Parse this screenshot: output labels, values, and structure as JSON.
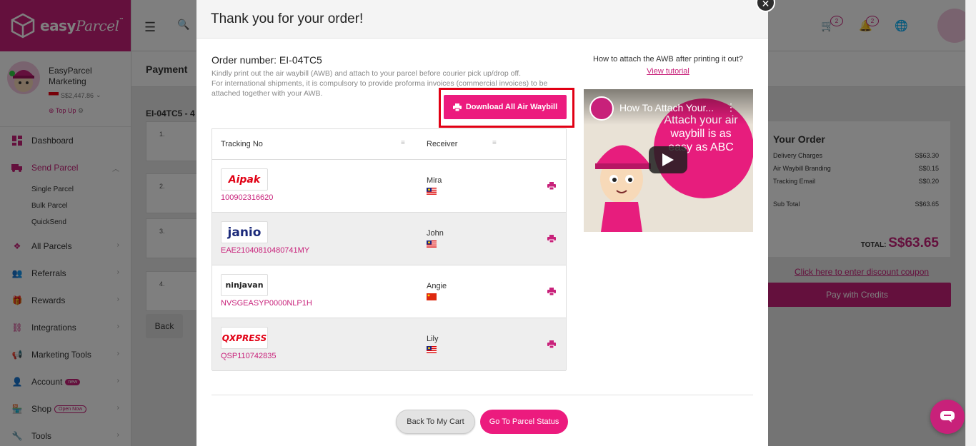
{
  "app": {
    "brand_prefix": "easy",
    "brand_suffix": "Parcel",
    "trademark": "™",
    "accent": "#c8217a"
  },
  "profile": {
    "name": "EasyParcel Marketing",
    "balance": "S$2,447.86",
    "topup_label": "Top Up"
  },
  "nav": {
    "items": [
      {
        "label": "Dashboard",
        "icon": "dashboard-icon"
      },
      {
        "label": "Send Parcel",
        "icon": "truck-icon"
      },
      {
        "label": "All Parcels",
        "icon": "boxes-icon"
      },
      {
        "label": "Referrals",
        "icon": "people-icon"
      },
      {
        "label": "Rewards",
        "icon": "gift-icon"
      },
      {
        "label": "Integrations",
        "icon": "link-icon"
      },
      {
        "label": "Marketing Tools",
        "icon": "megaphone-icon"
      },
      {
        "label": "Account",
        "icon": "user-icon",
        "badge": "new"
      },
      {
        "label": "Shop",
        "icon": "shop-icon",
        "badge": "Open Now"
      },
      {
        "label": "Tools",
        "icon": "wrench-icon"
      }
    ],
    "sub_items": [
      "Single Parcel",
      "Bulk Parcel",
      "QuickSend"
    ]
  },
  "topbar": {
    "cart_count": "2",
    "notif_count": "2"
  },
  "page": {
    "title": "Payment",
    "order_ref": "EI-04TC5 - 4",
    "back_label": "Back",
    "bg_rows": [
      "1.",
      "2.",
      "3.",
      "4."
    ]
  },
  "summary": {
    "title": "Your Order",
    "lines": [
      {
        "label": "Delivery Charges",
        "value": "S$63.30"
      },
      {
        "label": "Air Waybill Branding",
        "value": "S$0.15"
      },
      {
        "label": "Tracking Email",
        "value": "S$0.20"
      },
      {
        "label": "Sub Total",
        "value": "S$63.65"
      }
    ],
    "total_label": "TOTAL:",
    "total_value": "S$63.65",
    "coupon_link": "Click here to enter discount coupon",
    "pay_label": "Pay with Credits"
  },
  "modal": {
    "title": "Thank you for your order!",
    "order_number": "Order number: EI-04TC5",
    "instruction_1": "Kindly print out the air waybill (AWB) and attach to your parcel before courier pick up/drop off.",
    "instruction_2": "For international shipments, it is compulsory to provide proforma invoices (commercial invoices) to be attached together with your AWB.",
    "download_label": "Download All Air Waybill",
    "attach_question": "How to attach the AWB after printing it out?",
    "view_tutorial": "View tutorial",
    "video_title": "How To Attach Your...",
    "video_caption": "Attach your air waybill is as easy as ABC",
    "table": {
      "col_tracking": "Tracking No",
      "col_receiver": "Receiver",
      "rows": [
        {
          "courier": "Aipak",
          "tracking": "100902316620",
          "receiver": "Mira",
          "flag": "malaysia"
        },
        {
          "courier": "janio",
          "tracking": "EAE21040810480741MY",
          "receiver": "John",
          "flag": "malaysia"
        },
        {
          "courier": "ninjavan",
          "tracking": "NVSGEASYP0000NLP1H",
          "receiver": "Angie",
          "flag": "china"
        },
        {
          "courier": "QXPRESS",
          "tracking": "QSP110742835",
          "receiver": "Lily",
          "flag": "malaysia"
        }
      ]
    },
    "back_to_cart": "Back To My Cart",
    "go_to_status": "Go To Parcel Status"
  }
}
